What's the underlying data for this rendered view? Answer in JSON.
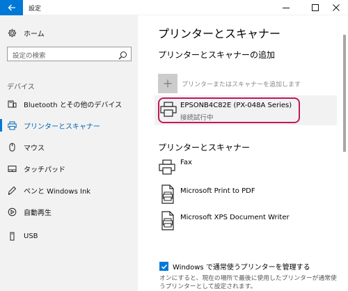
{
  "window": {
    "title": "設定",
    "minimize_label": "—",
    "maximize_label": "☐",
    "close_label": "✕"
  },
  "sidebar": {
    "home_label": "ホーム",
    "search_placeholder": "設定の検索",
    "section_label": "デバイス",
    "items": [
      {
        "label": "Bluetooth とその他のデバイス",
        "icon": "bluetooth-devices-icon"
      },
      {
        "label": "プリンターとスキャナー",
        "icon": "printer-icon",
        "selected": true
      },
      {
        "label": "マウス",
        "icon": "mouse-icon"
      },
      {
        "label": "タッチパッド",
        "icon": "touchpad-icon"
      },
      {
        "label": "ペンと Windows Ink",
        "icon": "pen-icon"
      },
      {
        "label": "自動再生",
        "icon": "autoplay-icon"
      },
      {
        "label": "USB",
        "icon": "usb-icon"
      }
    ]
  },
  "main": {
    "title": "プリンターとスキャナー",
    "add_section_title": "プリンターとスキャナーの追加",
    "add_button_label": "プリンターまたはスキャナーを追加します",
    "found_printer": {
      "name": "EPSONB4C82E (PX-048A Series)",
      "status": "接続試行中"
    },
    "installed_section_title": "プリンターとスキャナー",
    "printers": [
      {
        "name": "Fax",
        "icon": "fax-printer-icon"
      },
      {
        "name": "Microsoft Print to PDF",
        "icon": "pdf-printer-icon"
      },
      {
        "name": "Microsoft XPS Document Writer",
        "icon": "xps-printer-icon"
      }
    ],
    "default_printer_checkbox": {
      "label": "Windows で通常使うプリンターを管理する",
      "checked": true
    },
    "description": "オンにすると、現在の場所で最後に使用したプリンターが通常使うプリンターとして設定されます。"
  },
  "colors": {
    "accent": "#0078d7",
    "highlight": "#c2185b",
    "sidebar_bg": "#f2f2f2"
  }
}
